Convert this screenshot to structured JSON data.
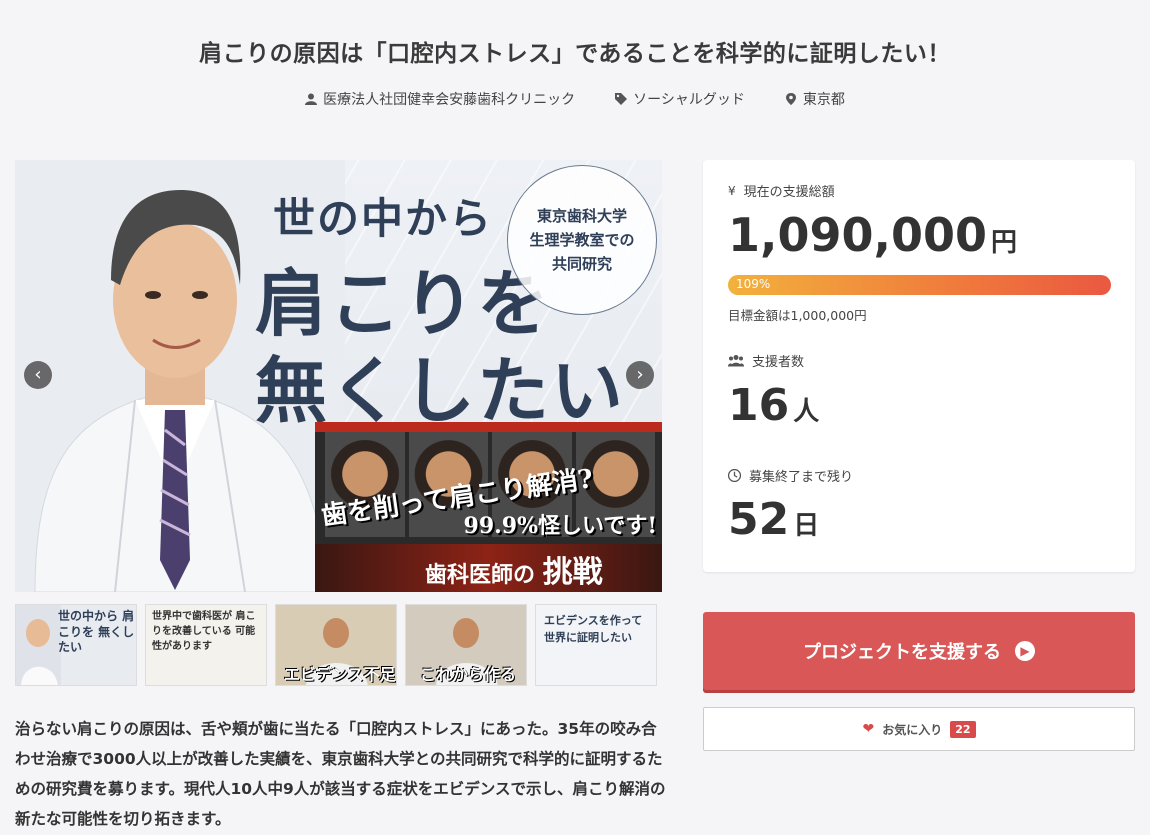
{
  "title": "肩こりの原因は「口腔内ストレス」であることを科学的に証明したい！",
  "meta": {
    "owner": "医療法人社団健幸会安藤歯科クリニック",
    "category": "ソーシャルグッド",
    "location": "東京都"
  },
  "hero": {
    "line1": "世の中から",
    "line2": "肩こりを",
    "line3": "無くしたい",
    "badge": [
      "東京歯科大学",
      "生理学教室での",
      "共同研究"
    ],
    "video_text1": "歯を削って肩こり解消?",
    "video_text2": "99.9%怪しいです!",
    "video_text3": "歯科医師の",
    "video_text3_b": "挑戦",
    "prev": "‹",
    "next": "›"
  },
  "thumbnails": [
    {
      "caption": "世の中から 肩こりを 無くしたい"
    },
    {
      "caption": "世界中で歯科医が 肩こりを改善している 可能性があります"
    },
    {
      "caption": "エビデンス不足"
    },
    {
      "caption": "これから作る"
    },
    {
      "caption": "エビデンスを作って 世界に証明したい"
    }
  ],
  "description": "治らない肩こりの原因は、舌や頬が歯に当たる「口腔内ストレス」にあった。35年の咬み合わせ治療で3000人以上が改善した実績を、東京歯科大学との共同研究で科学的に証明するための研究費を募ります。現代人10人中9人が該当する症状をエビデンスで示し、肩こり解消の新たな可能性を切り拓きます。",
  "stats": {
    "total_label": "現在の支援総額",
    "total_value": "1,090,000",
    "total_unit": "円",
    "progress_percent": 109,
    "progress_label": "109%",
    "goal_text": "目標金額は1,000,000円",
    "supporters_label": "支援者数",
    "supporters_value": "16",
    "supporters_unit": "人",
    "remaining_label": "募集終了まで残り",
    "remaining_value": "52",
    "remaining_unit": "日"
  },
  "actions": {
    "support_label": "プロジェクトを支援する",
    "fav_label": "お気に入り",
    "fav_count": "22"
  },
  "colors": {
    "accent": "#d95757",
    "progress_start": "#f2b13c",
    "progress_end": "#ea5840"
  }
}
